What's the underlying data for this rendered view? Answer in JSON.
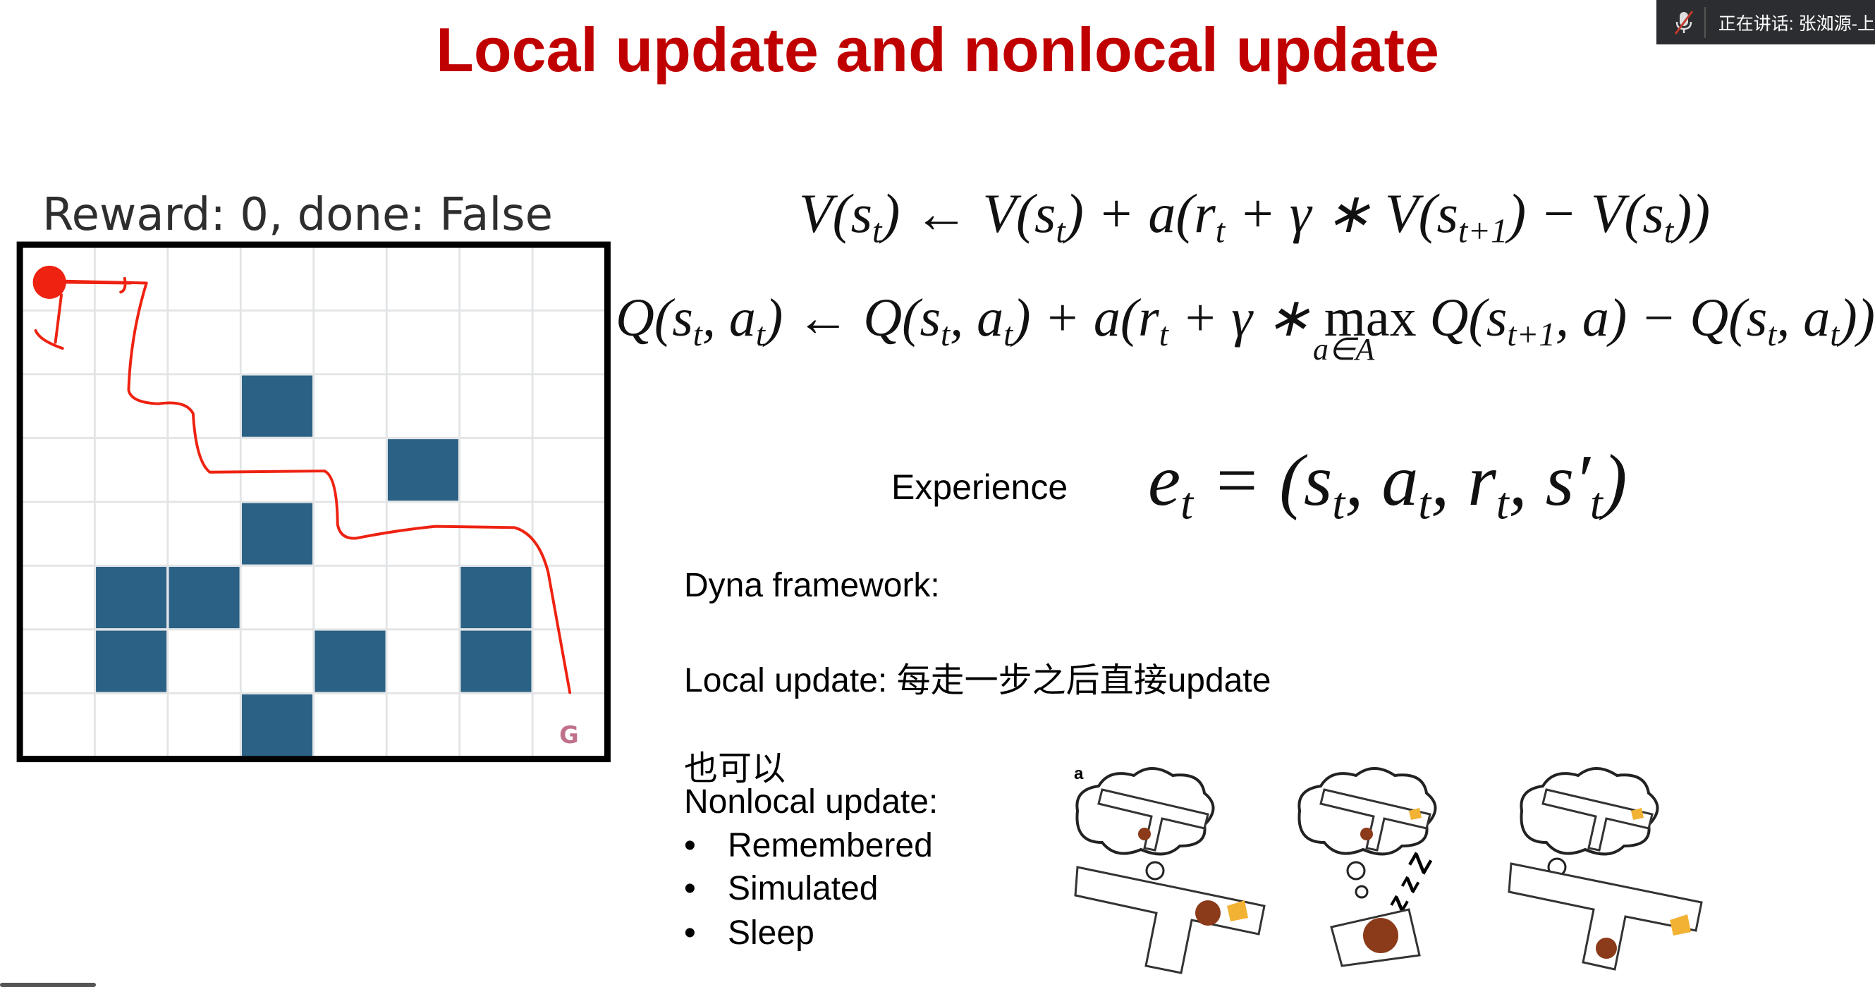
{
  "slide": {
    "title": "Local update and nonlocal update",
    "title_color": "#c00000"
  },
  "gridworld": {
    "status": "Reward: 0, done: False",
    "rows": 8,
    "cols": 8,
    "obstacles": [
      [
        2,
        3
      ],
      [
        3,
        5
      ],
      [
        4,
        3
      ],
      [
        5,
        1
      ],
      [
        5,
        2
      ],
      [
        5,
        6
      ],
      [
        6,
        1
      ],
      [
        6,
        4
      ],
      [
        6,
        6
      ],
      [
        7,
        3
      ]
    ],
    "goal": {
      "row": 7,
      "col": 7,
      "label": "G"
    },
    "obstacle_color": "#2b6184",
    "goal_color": "#c0708a",
    "annotation_color": "#ee2211"
  },
  "equations": {
    "v_update": [
      [
        "V(s",
        0
      ],
      [
        "t",
        1
      ],
      [
        ") ← V(s",
        0
      ],
      [
        "t",
        1
      ],
      [
        ") + a(r",
        0
      ],
      [
        "t",
        1
      ],
      [
        " + γ ∗ V(s",
        0
      ],
      [
        "t+1",
        1
      ],
      [
        ") − V(s",
        0
      ],
      [
        "t",
        1
      ],
      [
        "))",
        0
      ]
    ],
    "q_update": [
      [
        "Q(s",
        0
      ],
      [
        "t",
        1
      ],
      [
        ", a",
        0
      ],
      [
        "t",
        1
      ],
      [
        ") ← Q(s",
        0
      ],
      [
        "t",
        1
      ],
      [
        ", a",
        0
      ],
      [
        "t",
        1
      ],
      [
        ") + a(r",
        0
      ],
      [
        "t",
        1
      ],
      [
        " + γ ∗ ",
        0
      ],
      [
        "max",
        2
      ],
      [
        " Q(s",
        0
      ],
      [
        "t+1",
        1
      ],
      [
        ", a) − Q(s",
        0
      ],
      [
        "t",
        1
      ],
      [
        ", a",
        0
      ],
      [
        "t",
        1
      ],
      [
        "))",
        0
      ]
    ],
    "q_max_subscript": "a∈A",
    "experience_label": "Experience",
    "experience": [
      [
        "e",
        0
      ],
      [
        "t",
        1
      ],
      [
        " = (s",
        0
      ],
      [
        "t",
        1
      ],
      [
        ", a",
        0
      ],
      [
        "t",
        1
      ],
      [
        ", r",
        0
      ],
      [
        "t",
        1
      ],
      [
        ", s′",
        0
      ],
      [
        "t",
        1
      ],
      [
        ")",
        0
      ]
    ]
  },
  "text": {
    "dyna": "Dyna framework:",
    "local_update": "Local update: 每走一步之后直接update",
    "also": "也可以",
    "nonlocal_update": "Nonlocal update:",
    "bullets": [
      "Remembered",
      "Simulated",
      "Sleep"
    ],
    "bullet_char": "•"
  },
  "figure": {
    "panel_label": "a",
    "sleep_label": "z z Z"
  },
  "meeting_bar": {
    "mic_icon": "mic-muted-icon",
    "speaking": "正在讲话:  张洳源-上"
  }
}
